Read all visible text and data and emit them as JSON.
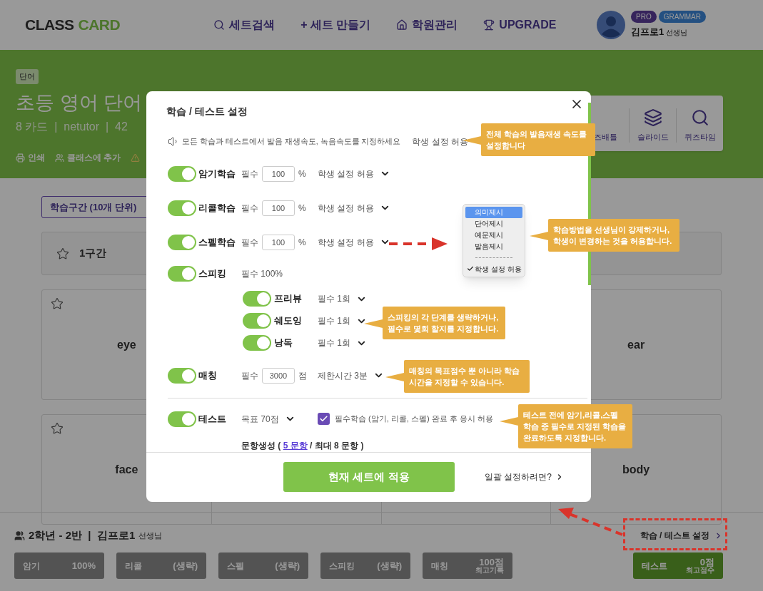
{
  "header": {
    "logo": [
      "CLASS",
      "CARD"
    ],
    "nav": [
      "세트검색",
      "+ 세트 만들기",
      "학원관리",
      "UPGRADE"
    ],
    "badges": [
      "PRO",
      "GRAMMAR"
    ],
    "user": {
      "name": "김프로1",
      "role": "선생님"
    }
  },
  "set": {
    "tag": "단어",
    "title": "초등 영어 단어",
    "meta": "8 카드  |  netutor  |  42",
    "actions": [
      "인쇄",
      "클래스에 추가"
    ],
    "modes": [
      "즈배틀",
      "슬라이드",
      "퀴즈타임"
    ]
  },
  "range_select": "학습구간 (10개 단위)",
  "section": {
    "label": "1구간",
    "starred": false
  },
  "card_rows": [
    {
      "left": {
        "word": "eye",
        "starred": false
      },
      "right": {
        "word": "ear"
      }
    },
    {
      "left": {
        "word": "face",
        "starred": false
      },
      "right": {
        "word": "body"
      }
    }
  ],
  "class_bar": {
    "class": "2학년 - 2반  |  김프로1",
    "role": "선생님",
    "settings_link": "학습 / 테스트 설정",
    "stats": [
      {
        "name": "암기",
        "value": "100%",
        "active": false
      },
      {
        "name": "리콜",
        "value": "(생략)",
        "active": false
      },
      {
        "name": "스펠",
        "value": "(생략)",
        "active": false
      },
      {
        "name": "스피킹",
        "value": "(생략)",
        "active": false
      },
      {
        "name": "매칭",
        "value": "100점",
        "note": "최고기록",
        "active": false
      },
      {
        "name": "테스트",
        "value": "0점",
        "note": "최고점수",
        "active": true
      }
    ]
  },
  "modal": {
    "title": "학습 / 테스트 설정",
    "audio": {
      "text": "모든 학습과 테스트에서 발음 재생속도, 녹음속도를 지정하세요",
      "option": "학생 설정 허용"
    },
    "items": [
      {
        "kind": "percent",
        "label": "암기학습",
        "on": true,
        "required": "필수",
        "value": "100",
        "unit": "%",
        "option": "학생 설정 허용"
      },
      {
        "kind": "percent",
        "label": "리콜학습",
        "on": true,
        "required": "필수",
        "value": "100",
        "unit": "%",
        "option": "학생 설정 허용"
      },
      {
        "kind": "percent",
        "label": "스펠학습",
        "on": true,
        "required": "필수",
        "value": "100",
        "unit": "%",
        "option": "학생 설정 허용"
      },
      {
        "kind": "speaking",
        "label": "스피킹",
        "on": true,
        "required": "필수 100%",
        "steps": [
          {
            "label": "프리뷰",
            "on": true,
            "option": "필수 1회"
          },
          {
            "label": "쉐도잉",
            "on": true,
            "option": "필수 1회"
          },
          {
            "label": "낭독",
            "on": true,
            "option": "필수 1회"
          }
        ]
      },
      {
        "kind": "percent",
        "label": "매칭",
        "on": true,
        "required": "필수",
        "value": "3000",
        "unit": "점",
        "option": "제한시간 3분"
      },
      {
        "kind": "test",
        "label": "테스트",
        "on": true,
        "option": "목표 70점",
        "checkbox": {
          "checked": true,
          "label": "필수학습 (암기, 리콜, 스펠) 완료 후 응시 허용"
        }
      }
    ],
    "question_gen": {
      "label": "문항생성 (",
      "count": "5 문항",
      "max": "/ 최대 8 문항 )"
    },
    "apply": "현재 세트에 적용",
    "bulk_link": "일괄 설정하려면?"
  },
  "method_menu": {
    "options": [
      {
        "label": "의미제시",
        "selected": true
      },
      {
        "label": "단어제시",
        "selected": false
      },
      {
        "label": "예문제시",
        "selected": false
      },
      {
        "label": "발음제시",
        "selected": false
      }
    ],
    "allow": {
      "label": "학생 설정 허용",
      "checked": true
    }
  },
  "callouts": [
    "전체 학습의 발음재생 속도를 설정합니다",
    "학습방법을 선생님이 강제하거나, 학생이 변경하는 것을 허용합니다.",
    "스피킹의 각 단계를 생략하거나, 필수로 몇회 할지를 지정합니다.",
    "매칭의 목표점수 뿐 아니라 학습시간을 지정할 수 있습니다.",
    "테스트 전에 암기,리콜,스펠 학습 중 필수로 지정된 학습을 완료하도록 지정합니다."
  ]
}
